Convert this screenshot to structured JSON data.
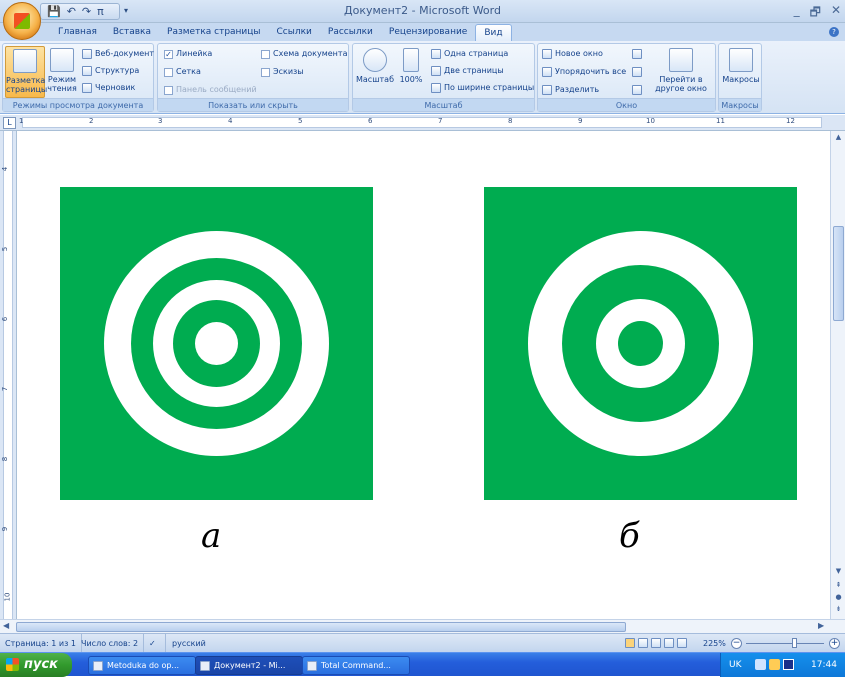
{
  "window": {
    "title": "Документ2 - Microsoft Word",
    "minimize": "_",
    "restore": "🗗",
    "close": "✕"
  },
  "qat": {
    "save_icon": "save-icon",
    "undo_icon": "undo-icon",
    "redo_icon": "redo-icon",
    "pi_label": "π",
    "more": "▾"
  },
  "tabs": [
    "Главная",
    "Вставка",
    "Разметка страницы",
    "Ссылки",
    "Рассылки",
    "Рецензирование",
    "Вид"
  ],
  "active_tab": "Вид",
  "ribbon": {
    "view_modes": {
      "label": "Режимы просмотра документа",
      "print_layout": "Разметка страницы",
      "reading": "Режим чтения",
      "web": "Веб-документ",
      "outline": "Структура",
      "draft": "Черновик"
    },
    "show_hide": {
      "label": "Показать или скрыть",
      "ruler": "Линейка",
      "gridlines": "Сетка",
      "message_bar": "Панель сообщений",
      "doc_map": "Схема документа",
      "thumbnails": "Эскизы",
      "ruler_checked": true
    },
    "zoom": {
      "label": "Масштаб",
      "zoom_btn": "Масштаб",
      "pct100": "100%",
      "one_page": "Одна страница",
      "two_pages": "Две страницы",
      "page_width": "По ширине страницы"
    },
    "window_grp": {
      "label": "Окно",
      "new_window": "Новое окно",
      "arrange_all": "Упорядочить все",
      "split": "Разделить",
      "switch_windows": "Перейти в другое окно"
    },
    "macros": {
      "label": "Макросы",
      "macros_btn": "Макросы"
    }
  },
  "ruler": {
    "h_numbers": [
      "1",
      "2",
      "3",
      "4",
      "5",
      "6",
      "7",
      "8",
      "9",
      "10",
      "11",
      "12"
    ],
    "v_numbers": [
      "4",
      "5",
      "6",
      "7",
      "8",
      "9",
      "10"
    ],
    "tab_selector": "L"
  },
  "figures": {
    "caption_a": "а",
    "caption_b": "б",
    "green": "#00ac50"
  },
  "status": {
    "page": "Страница: 1 из 1",
    "words": "Число слов: 2",
    "lang": "русский",
    "zoom": "225%"
  },
  "taskbar": {
    "start": "пуск",
    "items": [
      "Metoduka do op...",
      "Документ2 - Mi...",
      "Total Command..."
    ],
    "lang": "UK",
    "time": "17:44"
  }
}
